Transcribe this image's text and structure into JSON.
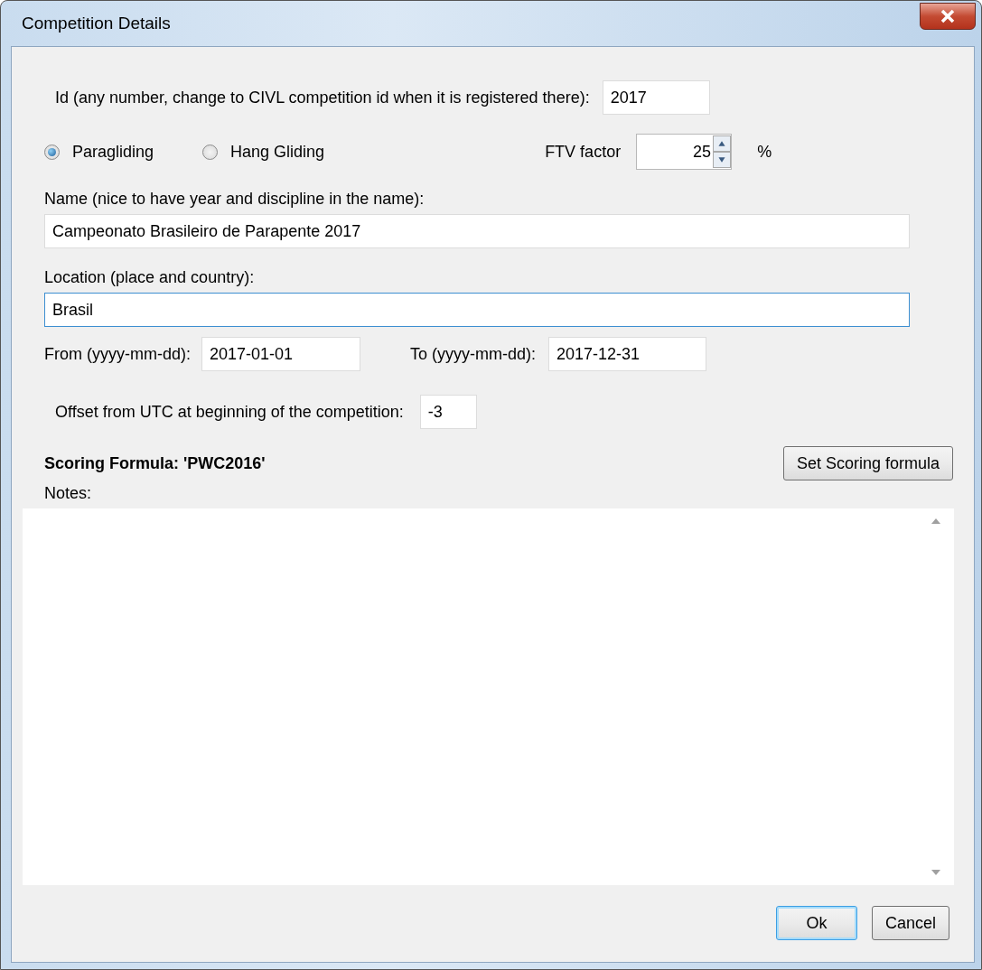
{
  "window": {
    "title": "Competition Details"
  },
  "id_field": {
    "label": "Id (any number, change to CIVL competition id when it is registered there):",
    "value": "2017"
  },
  "disciplines": [
    {
      "label": "Paragliding",
      "selected": true
    },
    {
      "label": "Hang Gliding",
      "selected": false
    }
  ],
  "ftv_factor": {
    "label": "FTV factor",
    "value": "25",
    "unit": "%"
  },
  "name_field": {
    "label": "Name (nice to have year and discipline in the name):",
    "value": "Campeonato Brasileiro de Parapente 2017"
  },
  "location_field": {
    "label": "Location (place and country):",
    "value": "Brasil",
    "focused": true
  },
  "from_field": {
    "label": "From (yyyy-mm-dd):",
    "value": "2017-01-01"
  },
  "to_field": {
    "label": "To (yyyy-mm-dd):",
    "value": "2017-12-31"
  },
  "offset_field": {
    "label": "Offset from UTC at beginning of the competition:",
    "value": "-3"
  },
  "scoring": {
    "label": "Scoring Formula: 'PWC2016'",
    "button": "Set Scoring formula"
  },
  "notes": {
    "label": "Notes:"
  },
  "buttons": [
    {
      "label": "Ok",
      "default": true
    },
    {
      "label": "Cancel",
      "default": false
    }
  ]
}
